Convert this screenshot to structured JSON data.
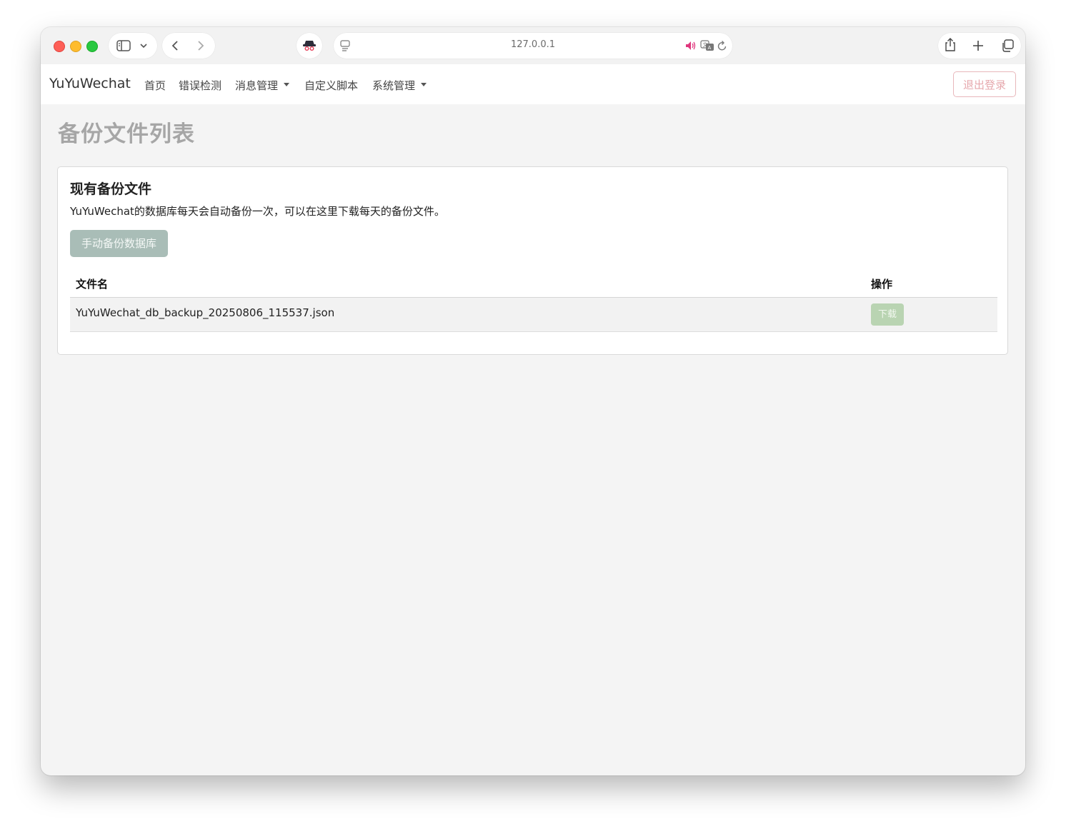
{
  "browser": {
    "url": "127.0.0.1",
    "icons": {
      "sidebar": "sidebar-icon",
      "chevron": "chevron-down-icon",
      "back": "back-icon",
      "forward": "forward-icon",
      "extension": "spy-extension-icon",
      "page": "page-info-icon",
      "audio": "speaker-icon",
      "translate": "translate-icon",
      "reload": "reload-icon",
      "share": "share-icon",
      "new_tab": "plus-icon",
      "tabs": "tabs-overview-icon"
    }
  },
  "navbar": {
    "brand": "YuYuWechat",
    "items": [
      {
        "label": "首页"
      },
      {
        "label": "错误检测"
      },
      {
        "label": "消息管理",
        "dropdown": true
      },
      {
        "label": "自定义脚本"
      },
      {
        "label": "系统管理",
        "dropdown": true
      }
    ],
    "logout": "退出登录"
  },
  "page": {
    "title": "备份文件列表"
  },
  "card": {
    "title": "现有备份文件",
    "description": "YuYuWechat的数据库每天会自动备份一次，可以在这里下载每天的备份文件。",
    "backup_button": "手动备份数据库",
    "table": {
      "headers": [
        "文件名",
        "操作"
      ],
      "rows": [
        {
          "file": "YuYuWechat_db_backup_20250806_115537.json",
          "action": "下载"
        }
      ]
    }
  },
  "colors": {
    "page_bg": "#f4f4f4",
    "backup_button": "#a9bdb7",
    "download_button": "#b9d4b2",
    "logout_border": "#e8b7bb"
  }
}
